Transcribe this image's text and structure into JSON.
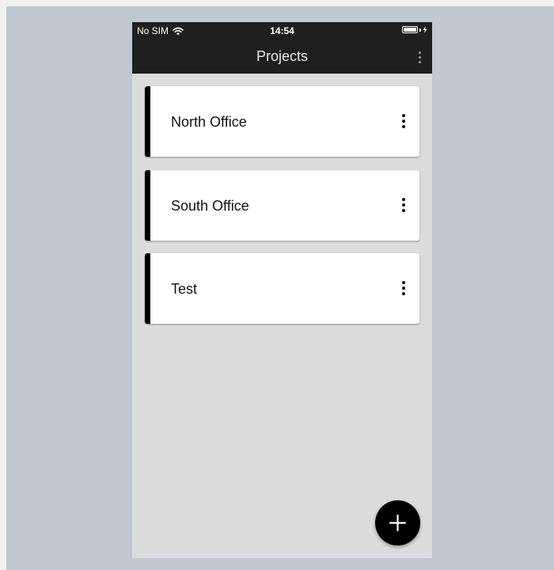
{
  "status_bar": {
    "carrier": "No SIM",
    "time": "14:54",
    "wifi_icon": "wifi-icon",
    "battery_icon": "battery-charging-icon"
  },
  "app_bar": {
    "title": "Projects",
    "menu_icon": "more-vertical-icon"
  },
  "projects": [
    {
      "name": "North Office"
    },
    {
      "name": "South Office"
    },
    {
      "name": "Test"
    }
  ],
  "fab": {
    "icon": "plus-icon"
  },
  "colors": {
    "bar_background": "#1f1f1f",
    "content_background": "#dcdcdc",
    "card_accent": "#000000",
    "fab_background": "#000000",
    "page_backdrop": "#c3c7cf"
  }
}
